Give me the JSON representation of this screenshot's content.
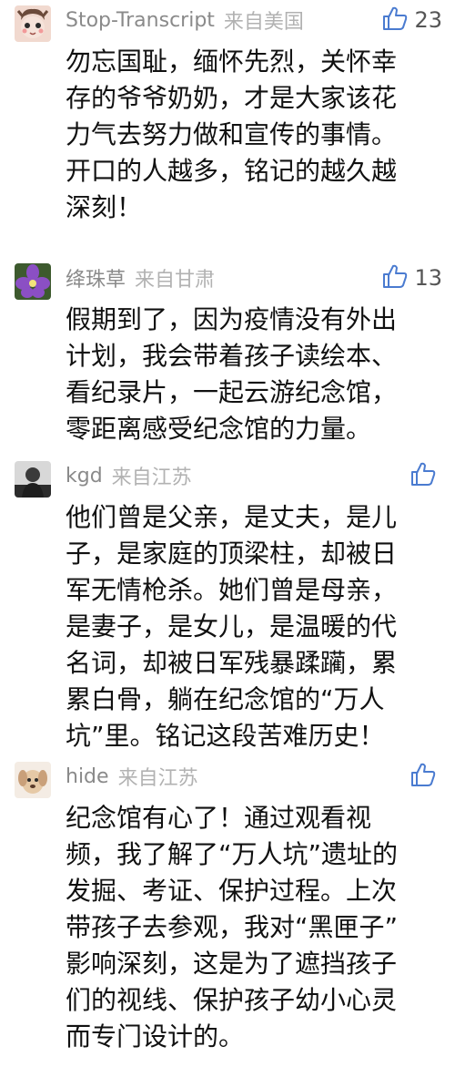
{
  "comments": [
    {
      "nickname": "Stop-Transcript",
      "location": "来自美国",
      "likes": "23",
      "lines": [
        "勿忘国耻，缅怀先烈，关怀幸",
        "存的爷爷奶奶，才是大家该花",
        "力气去努力做和宣传的事情。",
        "开口的人越多，铭记的越久越",
        "深刻！"
      ],
      "avatar_icon": "cartoon-avatar-icon"
    },
    {
      "nickname": "绛珠草",
      "location": "来自甘肃",
      "likes": "13",
      "lines": [
        "假期到了，因为疫情没有外出",
        "计划，我会带着孩子读绘本、",
        "看纪录片，一起云游纪念馆，",
        "零距离感受纪念馆的力量。"
      ],
      "avatar_icon": "purple-flower-avatar-icon"
    },
    {
      "nickname": "kgd",
      "location": "来自江苏",
      "likes": "",
      "lines": [
        "他们曾是父亲，是丈夫，是儿",
        "子，是家庭的顶梁柱，却被日",
        "军无情枪杀。她们曾是母亲，",
        "是妻子，是女儿，是温暖的代",
        "名词，却被日军残暴蹂躏，累",
        "累白骨，躺在纪念馆的“万人",
        "坑”里。铭记这段苦难历史！"
      ],
      "avatar_icon": "dark-figure-avatar-icon"
    },
    {
      "nickname": "hide",
      "location": "来自江苏",
      "likes": "",
      "lines": [
        "纪念馆有心了！通过观看视",
        "频，我了解了“万人坑”遗址的",
        "发掘、考证、保护过程。上次",
        "带孩子去参观，我对“黑匣子”",
        "影响深刻，这是为了遮挡孩子",
        "们的视线、保护孩子幼小心灵",
        "而专门设计的。"
      ],
      "avatar_icon": "puppy-avatar-icon"
    }
  ],
  "like_icon": "thumbs-up-icon"
}
